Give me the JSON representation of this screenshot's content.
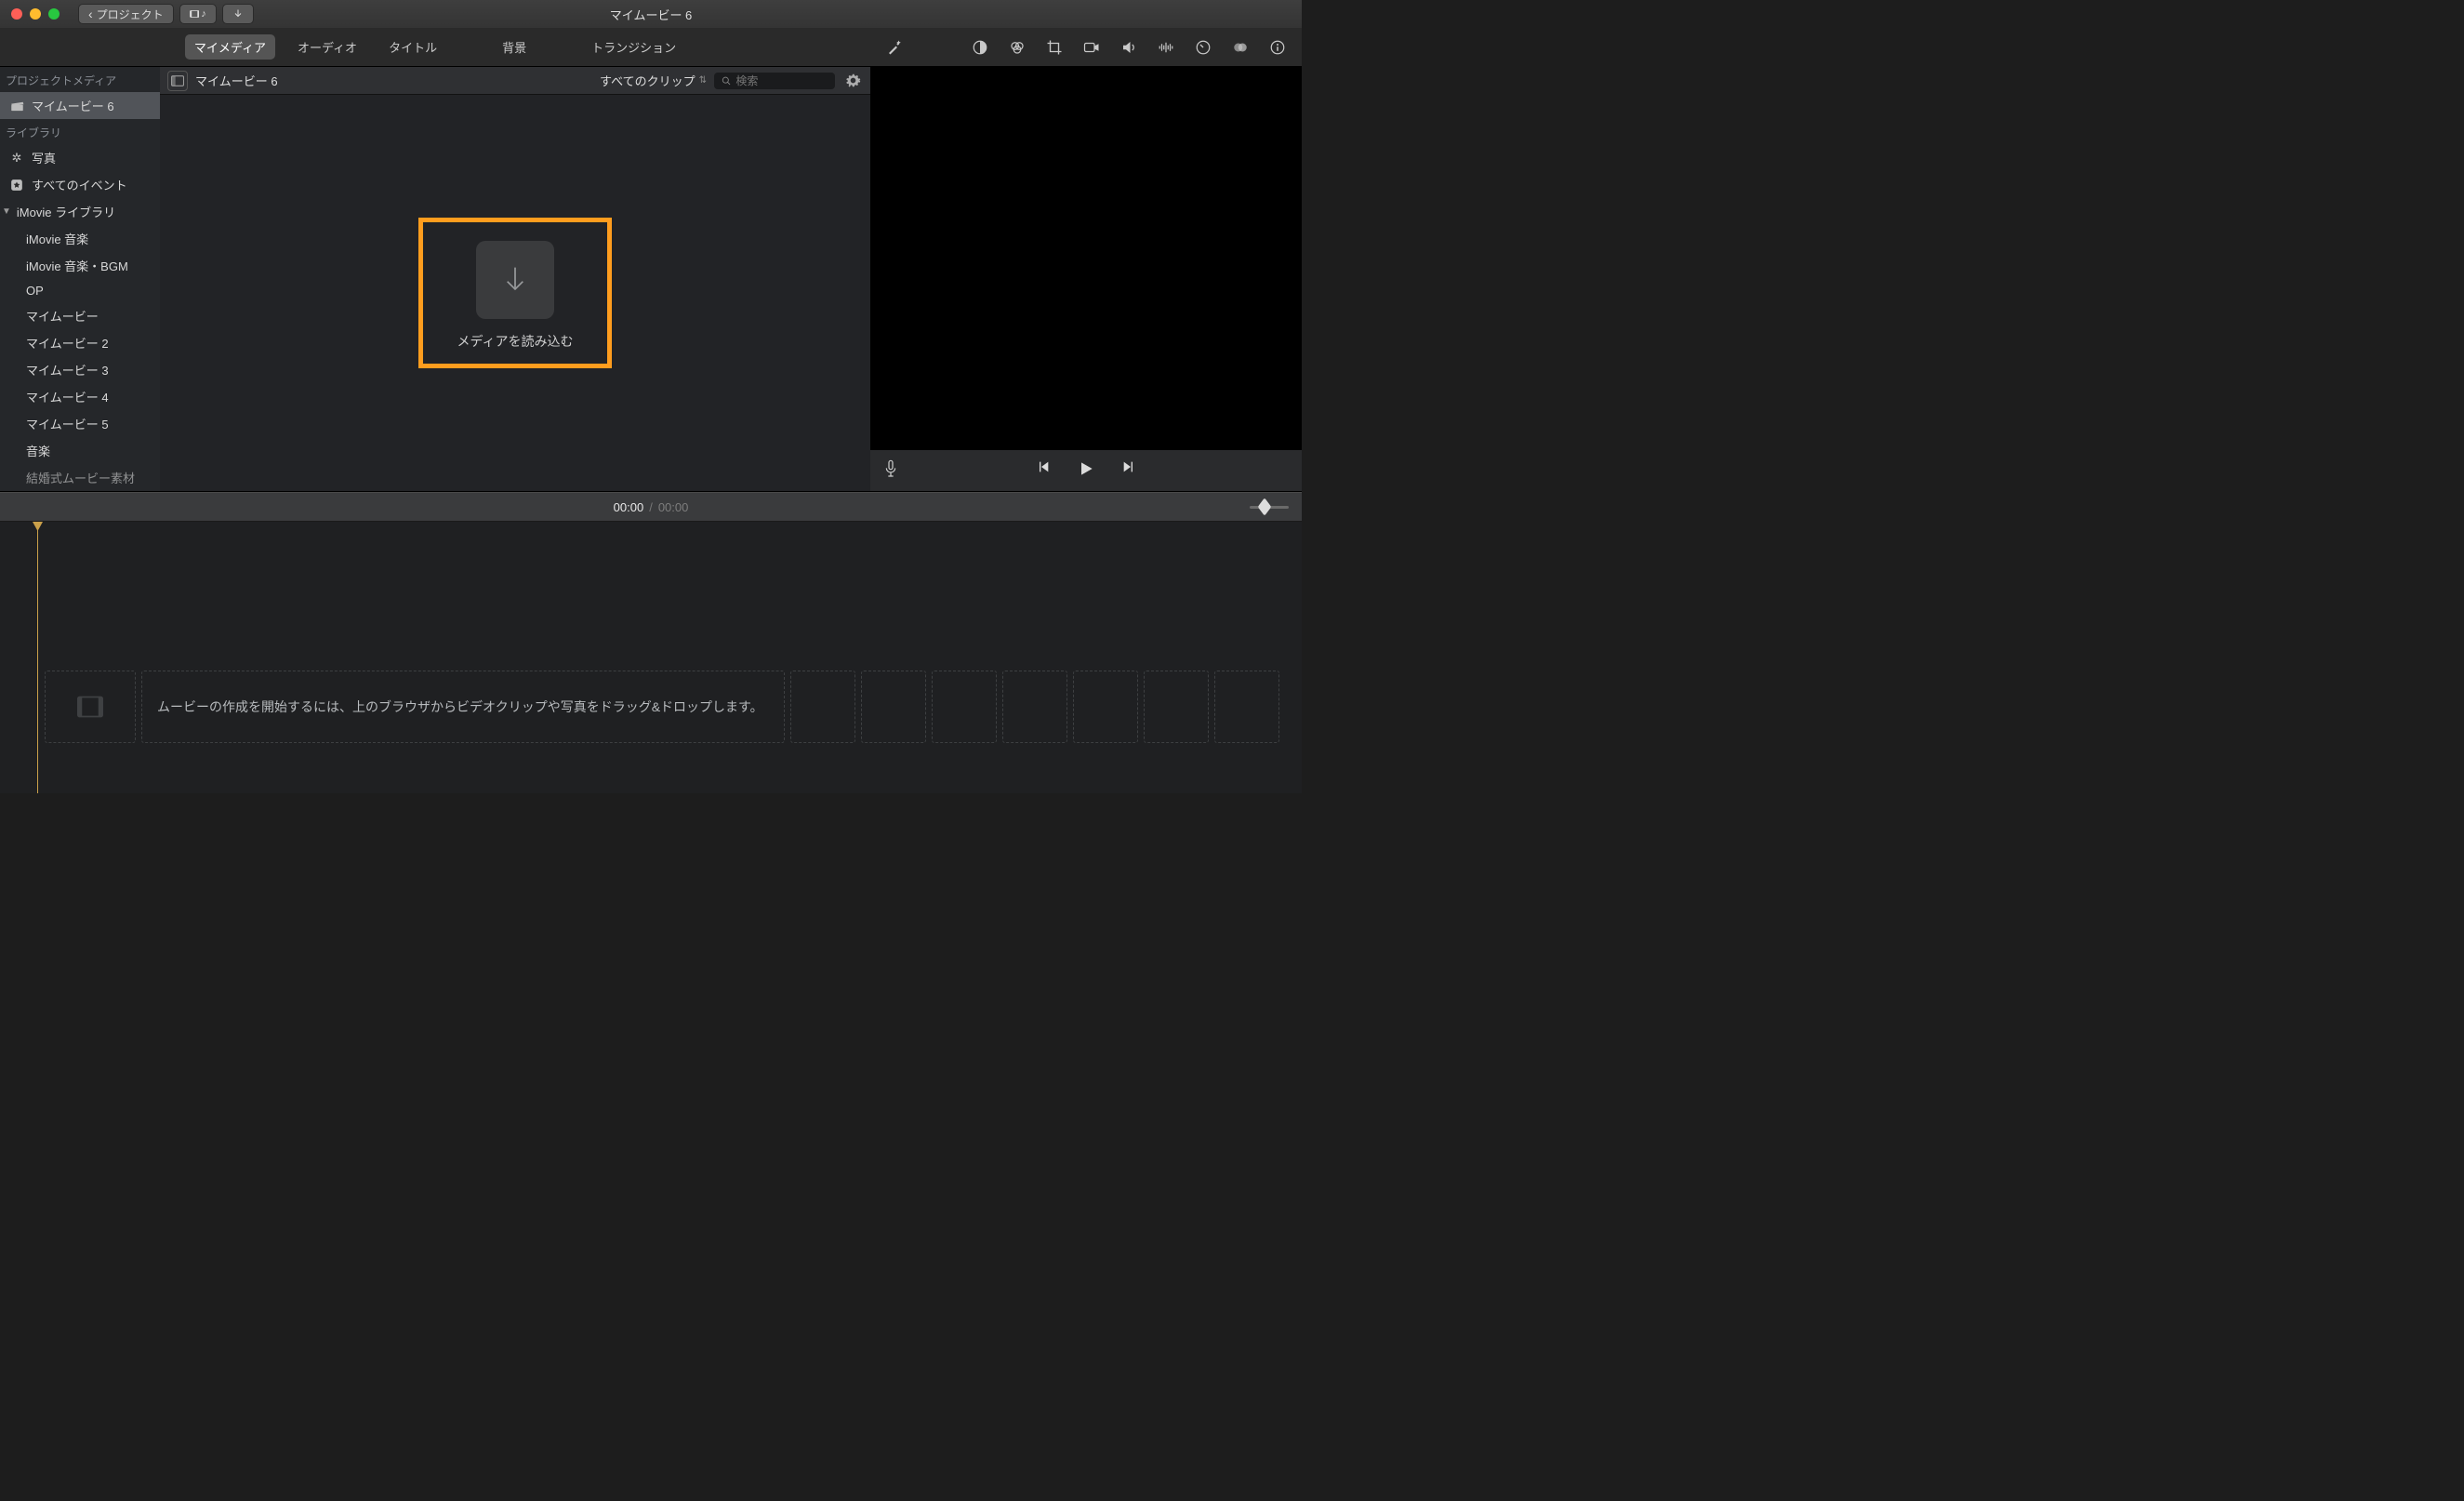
{
  "title": "マイムービー 6",
  "toolbar": {
    "back_label": "プロジェクト"
  },
  "tabs": {
    "mymedia": "マイメディア",
    "audio": "オーディオ",
    "titles": "タイトル",
    "backgrounds": "背景",
    "transitions": "トランジション"
  },
  "sidebar": {
    "section_project": "プロジェクトメディア",
    "project_name": "マイムービー 6",
    "section_library": "ライブラリ",
    "photos": "写真",
    "all_events": "すべてのイベント",
    "imovie_library": "iMovie ライブラリ",
    "items": [
      "iMovie 音楽",
      "iMovie 音楽・BGM",
      "OP",
      "マイムービー",
      "マイムービー 2",
      "マイムービー 3",
      "マイムービー 4",
      "マイムービー 5",
      "音楽",
      "結婚式ムービー素材"
    ]
  },
  "browser": {
    "title": "マイムービー 6",
    "filter_label": "すべてのクリップ",
    "search_placeholder": "検索",
    "import_label": "メディアを読み込む"
  },
  "timecode": {
    "current": "00:00",
    "total": "00:00"
  },
  "timeline": {
    "hint": "ムービーの作成を開始するには、上のブラウザからビデオクリップや写真をドラッグ&ドロップします。"
  }
}
